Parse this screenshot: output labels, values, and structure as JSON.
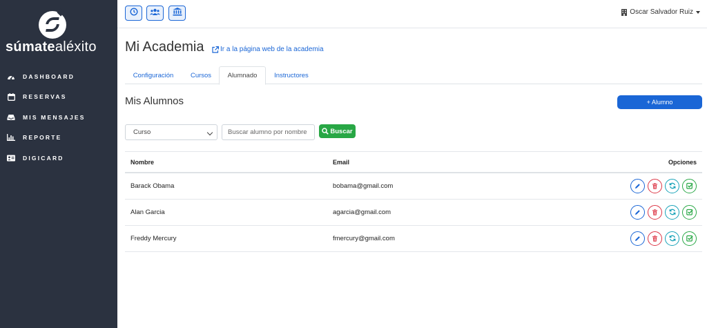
{
  "brand": {
    "bold": "súmate",
    "light": "aléxito"
  },
  "sidebar": {
    "items": [
      {
        "label": "DASHBOARD",
        "icon": "dashboard-icon"
      },
      {
        "label": "RESERVAS",
        "icon": "calendar-icon"
      },
      {
        "label": "MIS MENSAJES",
        "icon": "inbox-icon"
      },
      {
        "label": "REPORTE",
        "icon": "bar-chart-icon"
      },
      {
        "label": "DIGICARD",
        "icon": "id-card-icon"
      }
    ]
  },
  "topbar": {
    "buttons": [
      "clock-icon",
      "users-icon",
      "institution-icon"
    ],
    "user_name": "Oscar Salvador Ruiz"
  },
  "page": {
    "title": "Mi Academia",
    "web_link": "Ir a la página web de la academia"
  },
  "tabs": [
    {
      "label": "Configuración",
      "active": false
    },
    {
      "label": "Cursos",
      "active": false
    },
    {
      "label": "Alumnado",
      "active": true
    },
    {
      "label": "Instructores",
      "active": false
    }
  ],
  "students": {
    "title": "Mis Alumnos",
    "add_button": "+ Alumno",
    "course_select": "Curso",
    "search_placeholder": "Buscar alumno por nombre",
    "search_button": "Buscar",
    "columns": {
      "name": "Nombre",
      "email": "Email",
      "options": "Opciones"
    },
    "rows": [
      {
        "name": "Barack Obama",
        "email": "bobama@gmail.com"
      },
      {
        "name": "Alan Garcia",
        "email": "agarcia@gmail.com"
      },
      {
        "name": "Freddy Mercury",
        "email": "fmercury@gmail.com"
      }
    ]
  },
  "colors": {
    "sidebar_bg": "#2b3240",
    "primary": "#1a66d6",
    "success": "#28a745",
    "danger": "#dc3545",
    "info": "#17a2b8"
  }
}
